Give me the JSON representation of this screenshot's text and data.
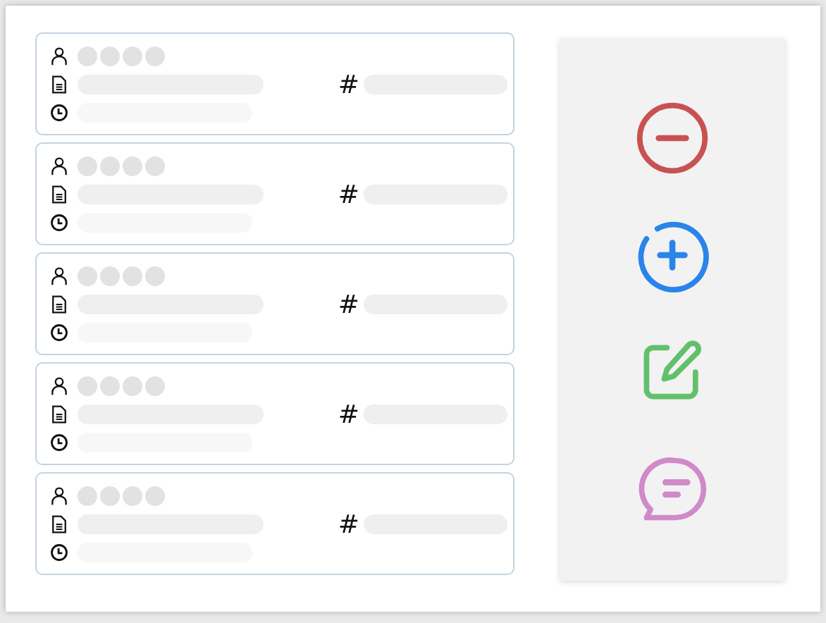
{
  "cards": [
    {
      "hash": "#"
    },
    {
      "hash": "#"
    },
    {
      "hash": "#"
    },
    {
      "hash": "#"
    },
    {
      "hash": "#"
    }
  ],
  "actions": [
    {
      "kind": "remove",
      "color": "#c85252"
    },
    {
      "kind": "add",
      "color": "#2a84ea"
    },
    {
      "kind": "edit",
      "color": "#62c06c"
    },
    {
      "kind": "message",
      "color": "#d08ac8"
    }
  ]
}
